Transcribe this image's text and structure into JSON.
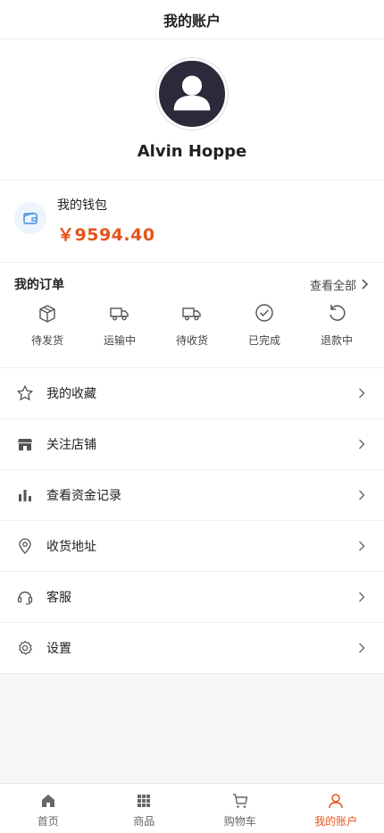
{
  "header": {
    "title": "我的账户"
  },
  "profile": {
    "name": "Alvin Hoppe"
  },
  "wallet": {
    "label": "我的钱包",
    "amount": "￥9594.40"
  },
  "orders": {
    "title": "我的订单",
    "view_all": "查看全部",
    "items": [
      {
        "label": "待发货",
        "icon": "package-icon"
      },
      {
        "label": "运输中",
        "icon": "truck-icon"
      },
      {
        "label": "待收货",
        "icon": "truck-icon"
      },
      {
        "label": "已完成",
        "icon": "check-circle-icon"
      },
      {
        "label": "退款中",
        "icon": "refresh-icon"
      }
    ]
  },
  "menu": {
    "items": [
      {
        "label": "我的收藏",
        "icon": "star-icon"
      },
      {
        "label": "关注店铺",
        "icon": "store-icon"
      },
      {
        "label": "查看资金记录",
        "icon": "bar-chart-icon"
      },
      {
        "label": "收货地址",
        "icon": "location-pin-icon"
      },
      {
        "label": "客服",
        "icon": "headset-icon"
      },
      {
        "label": "设置",
        "icon": "gear-icon"
      }
    ]
  },
  "tabbar": {
    "items": [
      {
        "label": "首页",
        "icon": "home-icon",
        "active": false
      },
      {
        "label": "商品",
        "icon": "grid-icon",
        "active": false
      },
      {
        "label": "购物车",
        "icon": "cart-icon",
        "active": false
      },
      {
        "label": "我的账户",
        "icon": "user-icon",
        "active": true
      }
    ]
  },
  "colors": {
    "accent": "#e8531b",
    "text": "#222222",
    "muted": "#666666",
    "avatar_bg": "#2b2a3b"
  }
}
